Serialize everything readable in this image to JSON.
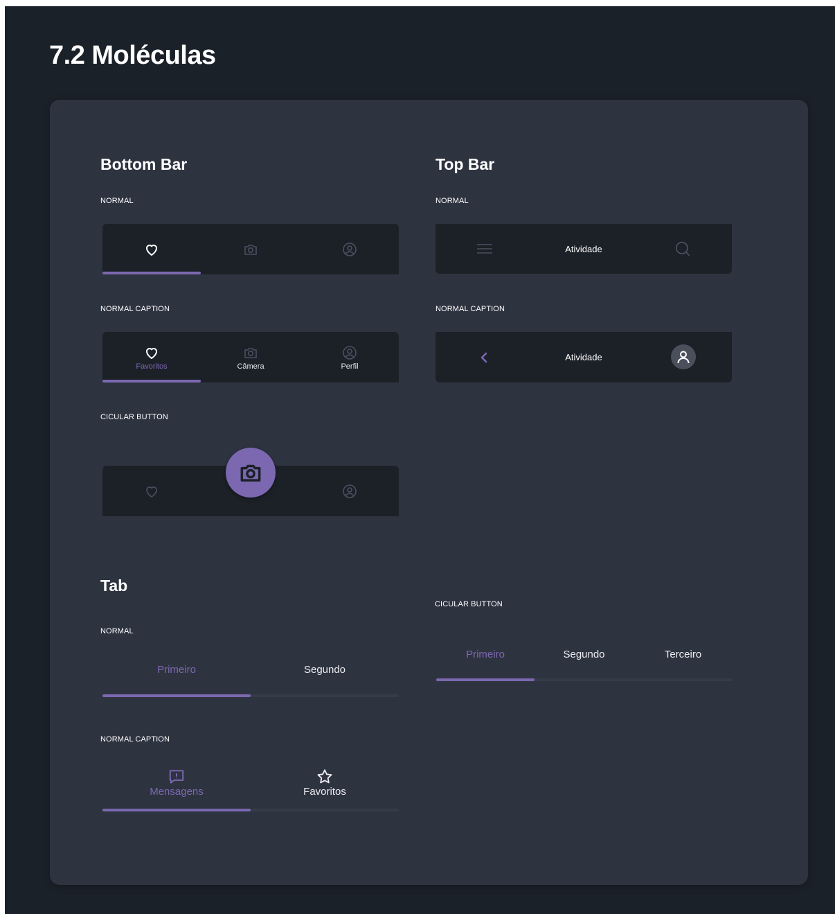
{
  "page": {
    "title": "7.2 Moléculas"
  },
  "colors": {
    "accent": "#7b68b0",
    "background": "#1b2129",
    "card": "#2e3340",
    "bar": "#1c2128",
    "track": "#363b48"
  },
  "bottom_bar": {
    "title": "Bottom Bar",
    "normal": {
      "label": "NORMAL",
      "items": [
        {
          "icon": "heart-icon",
          "active": true
        },
        {
          "icon": "camera-icon",
          "active": false
        },
        {
          "icon": "user-circle-icon",
          "active": false
        }
      ]
    },
    "normal_caption": {
      "label": "NORMAL CAPTION",
      "items": [
        {
          "icon": "heart-icon",
          "caption": "Favoritos",
          "active": true
        },
        {
          "icon": "camera-icon",
          "caption": "Câmera",
          "active": false
        },
        {
          "icon": "user-circle-icon",
          "caption": "Perfil",
          "active": false
        }
      ]
    },
    "circular_button": {
      "label": "CICULAR BUTTON",
      "items": [
        {
          "icon": "heart-icon"
        },
        {
          "icon": "camera-icon",
          "floating": true
        },
        {
          "icon": "user-circle-icon"
        }
      ]
    }
  },
  "top_bar": {
    "title": "Top Bar",
    "normal": {
      "label": "NORMAL",
      "left_icon": "menu-icon",
      "title": "Atividade",
      "right_icon": "search-icon"
    },
    "normal_caption": {
      "label": "NORMAL CAPTION",
      "left_icon": "chevron-left-icon",
      "title": "Atividade",
      "right_icon": "avatar-icon"
    }
  },
  "tab": {
    "title": "Tab",
    "normal": {
      "label": "NORMAL",
      "tabs": [
        {
          "label": "Primeiro",
          "active": true
        },
        {
          "label": "Segundo",
          "active": false
        }
      ],
      "progress": 0.5
    },
    "normal_caption": {
      "label": "NORMAL CAPTION",
      "tabs": [
        {
          "label": "Mensagens",
          "icon": "message-alert-icon",
          "active": true
        },
        {
          "label": "Favoritos",
          "icon": "star-icon",
          "active": false
        }
      ],
      "progress": 0.5
    },
    "circular_button": {
      "label": "CICULAR BUTTON",
      "tabs": [
        {
          "label": "Primeiro",
          "active": true
        },
        {
          "label": "Segundo",
          "active": false
        },
        {
          "label": "Terceiro",
          "active": false
        }
      ],
      "progress": 0.333
    }
  }
}
